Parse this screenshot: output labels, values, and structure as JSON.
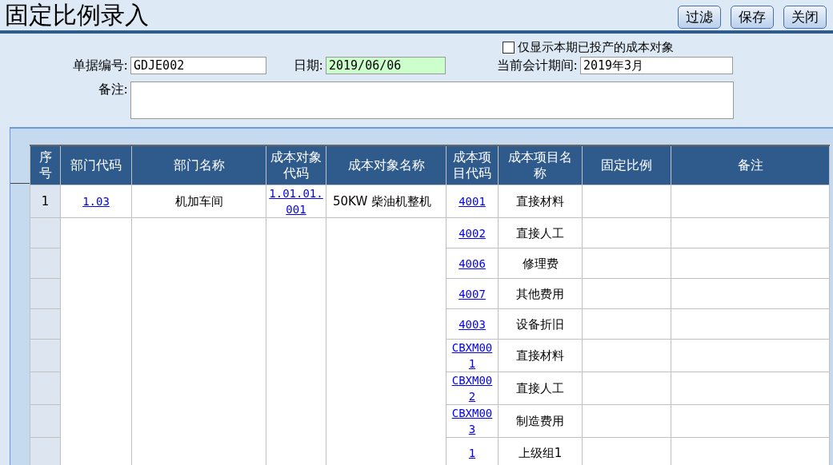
{
  "title": "固定比例录入",
  "toolbar": [
    {
      "label": "过滤"
    },
    {
      "label": "保存"
    },
    {
      "label": "关闭"
    }
  ],
  "filter_checkbox": {
    "label": "仅显示本期已投产的成本对象",
    "checked": false
  },
  "form": {
    "doc_no": {
      "label": "单据编号:",
      "value": "GDJE002"
    },
    "date": {
      "label": "日期:",
      "value": "2019/06/06"
    },
    "period": {
      "label": "当前会计期间:",
      "value": "2019年3月"
    },
    "note": {
      "label": "备注:"
    }
  },
  "table": {
    "columns": [
      "序号",
      "部门代码",
      "部门名称",
      "成本对象代码",
      "成本对象名称",
      "成本项目代码",
      "成本项目名称",
      "固定比例",
      "备注"
    ],
    "rows": [
      {
        "seq": "1",
        "dept_code": "1.03",
        "dept_name": "机加车间",
        "object_code": "1.01.01.001",
        "object_name": "50KW 柴油机整机",
        "item_code": "4001",
        "item_name": "直接材料"
      },
      {
        "item_code": "4002",
        "item_name": "直接人工"
      },
      {
        "item_code": "4006",
        "item_name": "修理费"
      },
      {
        "item_code": "4007",
        "item_name": "其他费用"
      },
      {
        "item_code": "4003",
        "item_name": "设备折旧"
      },
      {
        "item_code": "CBXM001",
        "item_name": "直接材料"
      },
      {
        "item_code": "CBXM002",
        "item_name": "直接人工"
      },
      {
        "item_code": "CBXM003",
        "item_name": "制造费用"
      },
      {
        "item_code": "1",
        "item_name": "上级组1"
      }
    ]
  }
}
